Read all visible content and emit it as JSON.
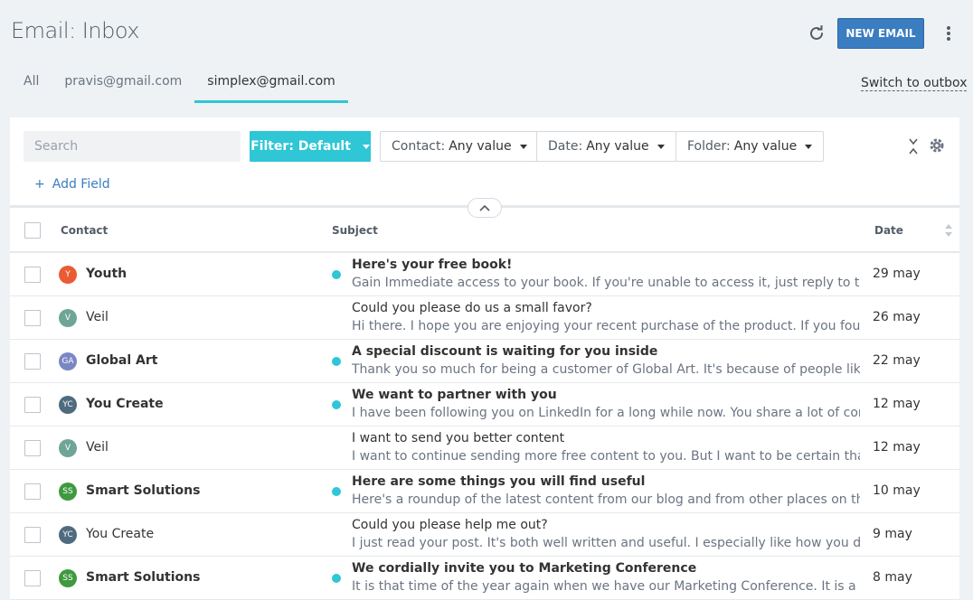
{
  "header": {
    "title": "Email: Inbox",
    "new_email_label": "NEW EMAIL"
  },
  "tabs": [
    {
      "label": "All",
      "active": false
    },
    {
      "label": "pravis@gmail.com",
      "active": false
    },
    {
      "label": "simplex@gmail.com",
      "active": true
    }
  ],
  "switch_outbox_label": "Switch to outbox",
  "filters": {
    "search_placeholder": "Search",
    "filter_button_label": "Filter: Default",
    "contact": {
      "label": "Contact:",
      "value": "Any value"
    },
    "date": {
      "label": "Date:",
      "value": "Any value"
    },
    "folder": {
      "label": "Folder:",
      "value": "Any value"
    },
    "add_field_label": "Add Field"
  },
  "table": {
    "columns": {
      "contact": "Contact",
      "subject": "Subject",
      "date": "Date"
    },
    "rows": [
      {
        "initials": "Y",
        "avatar_color": "#ea5b34",
        "contact": "Youth",
        "unread": true,
        "subject": "Here's your free book!",
        "preview": "Gain Immediate access to your book. If you're unable to access it, just reply to this email",
        "date": "29 may"
      },
      {
        "initials": "V",
        "avatar_color": "#6fa596",
        "contact": "Veil",
        "unread": false,
        "subject": "Could you please do us a small favor?",
        "preview": "Hi there. I hope you are enjoying your recent purchase of the product. If you found it useful",
        "date": "26 may"
      },
      {
        "initials": "GA",
        "avatar_color": "#7b86c4",
        "contact": "Global Art",
        "unread": true,
        "subject": "A special discount is waiting for you inside",
        "preview": "Thank you so much for being a customer of Global Art. It's because of people like you we",
        "date": "22 may"
      },
      {
        "initials": "YC",
        "avatar_color": "#4f6b7f",
        "contact": "You Create",
        "unread": true,
        "subject": "We want to partner with you",
        "preview": "I have been following you on LinkedIn for a long while now. You share a lot of content,",
        "date": "12 may"
      },
      {
        "initials": "V",
        "avatar_color": "#6fa596",
        "contact": "Veil",
        "unread": false,
        "subject": "I want to send you better content",
        "preview": "I want to continue sending more free content to you. But I want to be certain that I am",
        "date": "12 may"
      },
      {
        "initials": "SS",
        "avatar_color": "#3f9a3f",
        "contact": "Smart Solutions",
        "unread": true,
        "subject": "Here are some things you will find useful",
        "preview": "Here's a roundup of the latest content from our blog and from other places on the web",
        "date": "10 may"
      },
      {
        "initials": "YC",
        "avatar_color": "#4f6b7f",
        "contact": "You Create",
        "unread": false,
        "subject": "Could you please help me out?",
        "preview": "I just read your post. It's both well written and useful. I especially like how you described",
        "date": "9 may"
      },
      {
        "initials": "SS",
        "avatar_color": "#3f9a3f",
        "contact": "Smart Solutions",
        "unread": true,
        "subject": "We cordially invite you to Marketing Conference",
        "preview": "It is that time of the year again when we have our Marketing Conference. It is a day when",
        "date": "8 may"
      }
    ]
  },
  "colors": {
    "accent": "#2fc6d5",
    "primary": "#3a7dc1"
  }
}
